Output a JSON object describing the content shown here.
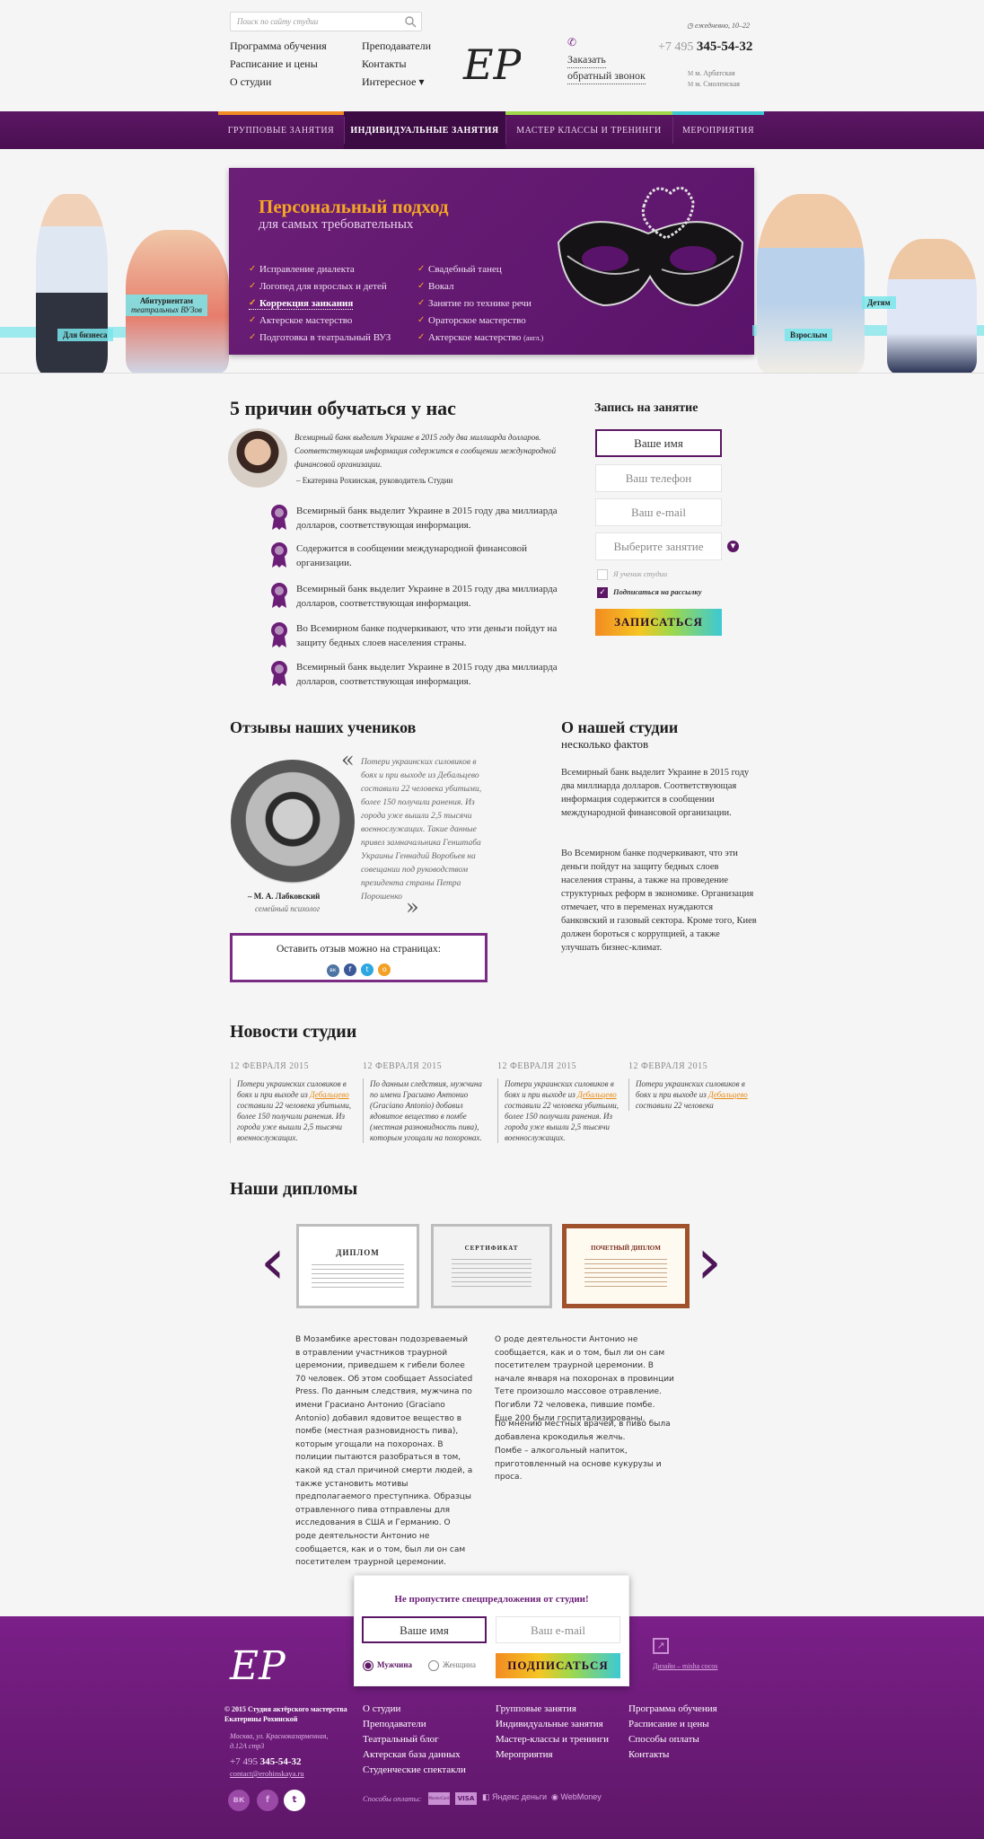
{
  "header": {
    "search_placeholder": "Поиск по сайту студии",
    "nav_left": [
      "Программа обучения",
      "Расписание и цены",
      "О студии"
    ],
    "nav_right": [
      "Преподаватели",
      "Контакты",
      "Интересное ▾"
    ],
    "logo_text": "ЕР",
    "callback": [
      "Заказать",
      "обратный звонок"
    ],
    "hours": "ежедневно, 10–22",
    "phone_code": "+7 495",
    "phone_number": "345-54-32",
    "metros": [
      "м. Арбатская",
      "м. Смоленская"
    ]
  },
  "nav": [
    "Групповые занятия",
    "Индивидуальные занятия",
    "Мастер классы и тренинги",
    "Мероприятия"
  ],
  "accent_colors": [
    "#f28b22",
    "#f5c623",
    "#9fd84b",
    "#3cc9d4"
  ],
  "hero": {
    "title": "Персональный подход",
    "subtitle": "для самых требовательных",
    "list_left": [
      "Исправление диалекта",
      "Логопед для взрослых и детей",
      "Коррекция заикания",
      "Актерское мастерство",
      "Подготовка в театральный ВУЗ"
    ],
    "list_right": [
      "Свадебный танец",
      "Вокал",
      "Занятие по технике речи",
      "Ораторское мастерство",
      "Актерское мастерство"
    ],
    "list_right_suffix": "(англ.)",
    "tags": {
      "abitur1": "Абитуриентам",
      "abitur2": "театральных ВУЗов",
      "business": "Для бизнеса",
      "adults": "Взрослым",
      "kids": "Детям"
    }
  },
  "reasons": {
    "title": "5 причин обучаться у нас",
    "quote": "Всемирный банк выделит Украине в 2015 году два миллиарда долларов. Соответствующая информация содержится в сообщении международной финансовой организации.",
    "author": "– Екатерина Рохинская, руководитель Студии",
    "items": [
      "Всемирный банк выделит Украине в 2015 году два миллиарда долларов, соответствующая информация.",
      "Содержится в сообщении международной финансовой организации.",
      "Всемирный банк выделит Украине в 2015 году два миллиарда долларов, соответствующая информация.",
      "Во Всемирном банке подчеркивают, что эти деньги пойдут на защиту бедных слоев населения страны.",
      "Всемирный банк выделит Украине в 2015 году два миллиарда долларов, соответствующая информация."
    ]
  },
  "signup": {
    "title": "Запись на занятие",
    "name": "Ваше имя",
    "phone": "Ваш телефон",
    "email": "Ваш e-mail",
    "select": "Выберите занятие",
    "opt_student": "Я ученик студии",
    "opt_subscribe": "Подписаться на рассылку",
    "button": "ЗАПИСАТЬСЯ"
  },
  "reviews": {
    "title": "Отзывы наших учеников",
    "text": "Потери украинских силовиков в боях и при выходе из Дебальцево составили 22 человека убитыми, более 150 получили ранения. Из города уже вышли 2,5 тысячи военнослужащих. Такие данные привел замначальника Генштаба Украины Геннадий Воробьев на совещании под руководством президента страны Петра Порошенко",
    "author": "– М. А. Лабковский",
    "author_role": "семейный психолог",
    "leave_review": "Оставить отзыв можно на страницах:",
    "social": [
      "вк",
      "f",
      "t",
      "о"
    ]
  },
  "about": {
    "title": "О нашей студии",
    "subtitle": "несколько фактов",
    "p1": "Всемирный банк выделит Украине в 2015 году два миллиарда долларов. Соответствующая информация содержится в сообщении международной финансовой организации.",
    "p2": "Во Всемирном банке подчеркивают, что эти деньги пойдут на защиту бедных слоев населения страны, а также на проведение структурных реформ в экономике. Организация отмечает, что в переменах нуждаются банковский и газовый сектора. Кроме того, Киев должен бороться с коррупцией, а также улучшать бизнес-климат."
  },
  "news": {
    "title": "Новости студии",
    "items": [
      {
        "date": "12 ФЕВРАЛЯ 2015",
        "pre": "Потери украинских силовиков в боях и при выходе из ",
        "link": "Дебальцево",
        "post": " составили 22 человека убитыми, более 150 получили ранения. Из города уже вышли 2,5 тысячи военнослужащих."
      },
      {
        "date": "12 ФЕВРАЛЯ 2015",
        "pre": "По данным следствия, мужчина по имени Грасиано Антонио (Graciano Antonio) добавил ядовитое вещество в помбе (местная разновидность пива), которым угощали на похоронах.",
        "link": "",
        "post": ""
      },
      {
        "date": "12 ФЕВРАЛЯ 2015",
        "pre": "Потери украинских силовиков в боях и при выходе из ",
        "link": "Дебальцево",
        "post": " составили 22 человека убитыми, более 150 получили ранения. Из города уже вышли 2,5 тысячи военнослужащих."
      },
      {
        "date": "12 ФЕВРАЛЯ 2015",
        "pre": "Потери украинских силовиков в боях и при выходе из ",
        "link": "Дебальцево",
        "post": " составили 22 человека"
      }
    ]
  },
  "diplomas": {
    "title": "Наши дипломы",
    "cards": [
      "ДИПЛОМ",
      "СЕРТИФИКАТ",
      "ПОЧЕТНЫЙ ДИПЛОМ"
    ],
    "text_left": "В Мозамбике арестован подозреваемый в отравлении участников траурной церемонии, приведшем к гибели более 70 человек. Об этом сообщает Associated Press. По данным следствия, мужчина по имени Грасиано Антонио (Graciano Antonio) добавил ядовитое вещество в помбе (местная разновидность пива), которым угощали на похоронах. В полиции пытаются разобраться в том, какой яд стал причиной смерти людей, а также установить мотивы предполагаемого преступника. Образцы отравленного пива отправлены для исследования в США и Германию. О роде деятельности Антонио не сообщается, как и о том, был ли он сам посетителем траурной церемонии.",
    "text_right_1": "О роде деятельности Антонио не сообщается, как и о том, был ли он сам посетителем траурной церемонии. В начале января на похоронах в провинции Тете произошло массовое отравление. Погибли 72 человека, пившие помбе. Еще 200 были госпитализированы.",
    "text_right_2": "По мнению местных врачей, в пиво была добавлена крокодилья желчь.",
    "text_right_3": "Помбе – алкогольный напиток, приготовленный на основе кукурузы и проса."
  },
  "subscribe": {
    "title": "Не пропустите спецпредложения от студии!",
    "name": "Ваше имя",
    "email": "Ваш e-mail",
    "male": "Мужчина",
    "female": "Женщина",
    "button": "ПОДПИСАТЬСЯ"
  },
  "footer": {
    "copyright": "© 2015 Студия актёрского мастерства Екатерины Рохинской",
    "address": "Москва, ул. Красноказарменная, д.12А стр3",
    "phone_code": "+7 495",
    "phone_number": "345-54-32",
    "email": "contact@erohinskaya.ru",
    "design": "Дизайн – misha cocos",
    "col1": [
      "О студии",
      "Преподаватели",
      "Театральный блог",
      "Актерская база данных",
      "Студенческие спектакли"
    ],
    "col2": [
      "Групповые занятия",
      "Индивидуальные занятия",
      "Мастер-классы и тренинги",
      "Мероприятия"
    ],
    "col3": [
      "Программа обучения",
      "Расписание и цены",
      "Способы оплаты",
      "Контакты"
    ],
    "payment_label": "Способы оплаты:",
    "payments": [
      "MasterCard",
      "VISA",
      "Яндекс деньги",
      "WebMoney"
    ]
  }
}
